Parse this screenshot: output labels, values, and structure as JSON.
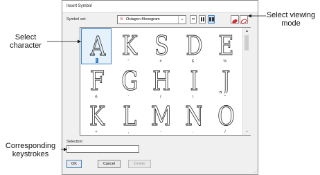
{
  "dialog": {
    "title": "Insert Symbol",
    "symbol_set_label": "Symbol set:",
    "symbol_set_value": "Octagon Monogram",
    "selection_label": "Selection:",
    "selection_value": "!",
    "ok_label": "OK",
    "cancel_label": "Cancel",
    "delete_label": "Delete"
  },
  "characters": [
    {
      "glyph": "A",
      "key": "!"
    },
    {
      "glyph": "K",
      "key": "\""
    },
    {
      "glyph": "S",
      "key": "#"
    },
    {
      "glyph": "D",
      "key": "$"
    },
    {
      "glyph": "E",
      "key": "%"
    },
    {
      "glyph": "F",
      "key": "&"
    },
    {
      "glyph": "G",
      "key": "'"
    },
    {
      "glyph": "H",
      "key": "("
    },
    {
      "glyph": "I",
      "key": ")"
    },
    {
      "glyph": "J",
      "key": "*"
    },
    {
      "glyph": "K",
      "key": "+"
    },
    {
      "glyph": "L",
      "key": ","
    },
    {
      "glyph": "M",
      "key": "-"
    },
    {
      "glyph": "N",
      "key": "."
    },
    {
      "glyph": "O",
      "key": "/"
    }
  ],
  "callouts": {
    "select_character": "Select character",
    "select_viewing_mode": "Select viewing mode",
    "corresponding_keystrokes": "Corresponding keystrokes"
  },
  "icons": {
    "symbol_set": "monogram-icon",
    "view_small": "small-grid-icon",
    "view_medium": "medium-grid-icon",
    "view_large": "large-grid-icon",
    "render_3d": "3d-render-icon",
    "render_outline": "outline-render-icon"
  },
  "colors": {
    "selection_accent": "#3c7fc0",
    "dialog_bg": "#f0f0f0",
    "render_red": "#d03030"
  }
}
